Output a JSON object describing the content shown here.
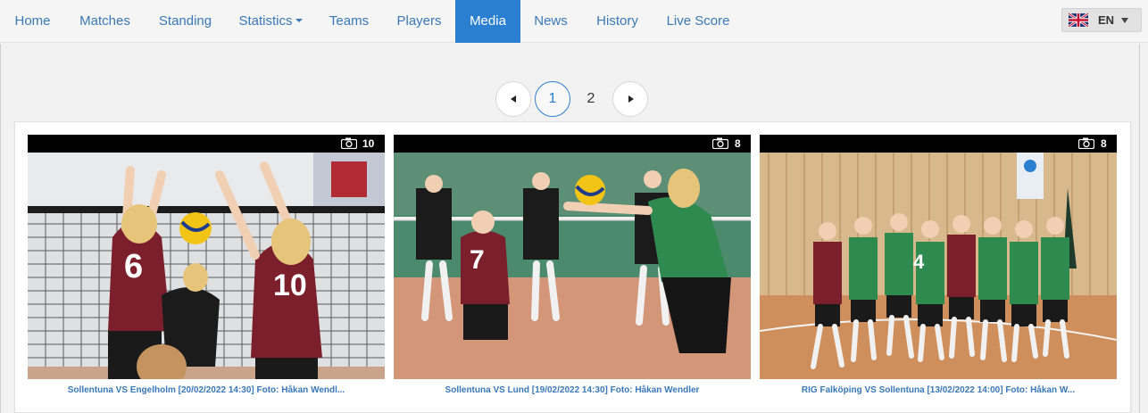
{
  "nav": {
    "items": [
      {
        "label": "Home"
      },
      {
        "label": "Matches"
      },
      {
        "label": "Standing"
      },
      {
        "label": "Statistics"
      },
      {
        "label": "Teams"
      },
      {
        "label": "Players"
      },
      {
        "label": "Media"
      },
      {
        "label": "News"
      },
      {
        "label": "History"
      },
      {
        "label": "Live Score"
      }
    ],
    "active": "Media",
    "colors": {
      "link": "#3a78b8",
      "active_bg": "#2b7fd1"
    }
  },
  "language": {
    "code": "EN",
    "flag": "uk-flag-icon"
  },
  "pagination": {
    "prev_icon": "triangle-left-icon",
    "pages": [
      "1",
      "2"
    ],
    "current": "1",
    "next_icon": "triangle-right-icon"
  },
  "gallery": [
    {
      "count": "10",
      "icon": "camera-icon",
      "caption": "Sollentuna VS Engelholm [20/02/2022 14:30] Foto: Håkan Wendl..."
    },
    {
      "count": "8",
      "icon": "camera-icon",
      "caption": "Sollentuna VS Lund [19/02/2022 14:30] Foto: Håkan Wendler"
    },
    {
      "count": "8",
      "icon": "camera-icon",
      "caption": "RIG Falköping VS Sollentuna [13/02/2022 14:00] Foto: Håkan W..."
    }
  ]
}
